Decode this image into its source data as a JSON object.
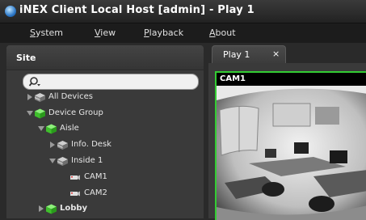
{
  "window": {
    "title": "iNEX Client Local Host [admin] - Play  1"
  },
  "menu": [
    {
      "first": "S",
      "rest": "ystem"
    },
    {
      "first": "V",
      "rest": "iew"
    },
    {
      "first": "P",
      "rest": "layback"
    },
    {
      "first": "A",
      "rest": "bout"
    }
  ],
  "site_panel": {
    "header": "Site",
    "search": {
      "value": "",
      "placeholder": ""
    }
  },
  "tree": [
    {
      "label": "All Devices",
      "icon": "device-stack-icon",
      "expanded": false
    },
    {
      "label": "Device Group",
      "icon": "group-cube-icon",
      "expanded": true
    },
    {
      "label": "Aisle",
      "icon": "group-cube-icon",
      "expanded": true
    },
    {
      "label": "Info. Desk",
      "icon": "device-stack-icon",
      "expanded": false
    },
    {
      "label": "Inside 1",
      "icon": "device-stack-icon",
      "expanded": true
    },
    {
      "label": "CAM1",
      "icon": "camera-icon"
    },
    {
      "label": "CAM2",
      "icon": "camera-icon"
    },
    {
      "label": "Lobby",
      "icon": "group-cube-icon",
      "expanded": false
    }
  ],
  "tabs": [
    {
      "label": "Play  1",
      "close": "×"
    }
  ],
  "camera_view": {
    "title": "CAM1",
    "border_color": "#33cc33"
  },
  "colors": {
    "accent_green": "#33cc33",
    "group_green": "#4cd13a",
    "background": "#2a2a2a"
  }
}
